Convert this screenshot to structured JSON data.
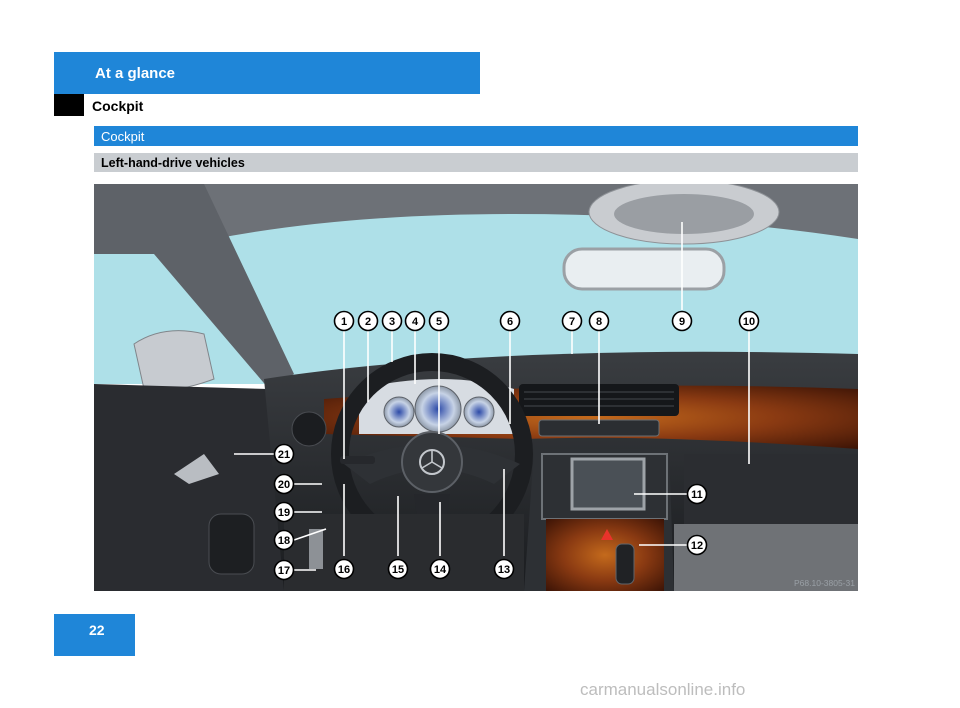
{
  "header": {
    "section_title": "At a glance",
    "page_heading": "Cockpit"
  },
  "section_bar": {
    "label": "Cockpit"
  },
  "subsection_bar": {
    "label": "Left-hand-drive vehicles"
  },
  "illustration": {
    "image_code": "P68.10-3805-31",
    "callouts": [
      "1",
      "2",
      "3",
      "4",
      "5",
      "6",
      "7",
      "8",
      "9",
      "10",
      "11",
      "12",
      "13",
      "14",
      "15",
      "16",
      "17",
      "18",
      "19",
      "20",
      "21"
    ]
  },
  "footer": {
    "page_number": "22",
    "watermark": "carmanualsonline.info"
  },
  "colors": {
    "brand_blue": "#1f86d8",
    "subsection_grey": "#c9cdd1",
    "windshield_sky": "#aee0e8",
    "wood_trim": "#8a3a12"
  }
}
